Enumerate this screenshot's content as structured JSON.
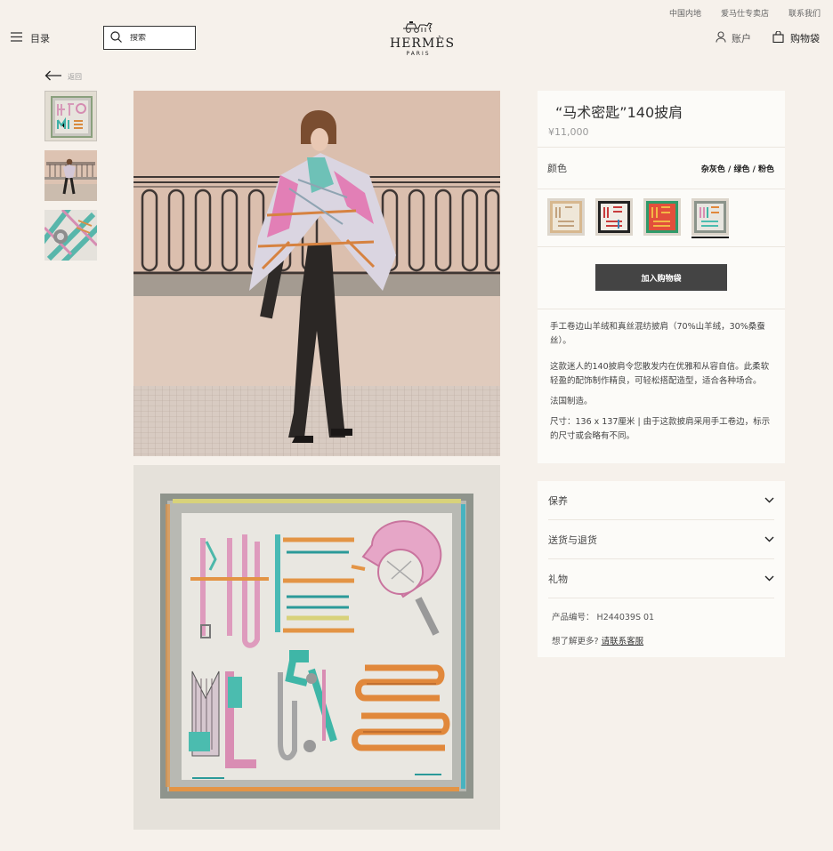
{
  "utility_links": [
    "中国内地",
    "爱马仕专卖店",
    "联系我们"
  ],
  "header": {
    "menu_label": "目录",
    "search_placeholder": "搜索",
    "brand": "HERMÈS",
    "brand_city": "PARIS",
    "account_label": "账户",
    "bag_label": "购物袋"
  },
  "back_label": "返回",
  "product": {
    "title": "“马术密匙”140披肩",
    "price": "¥11,000",
    "color_label": "颜色",
    "color_value": "杂灰色 / 绿色 / 粉色",
    "add_to_bag": "加入购物袋",
    "description": [
      "手工卷边山羊绒和真丝混纺披肩（70%山羊绒，30%桑蚕丝）。",
      "这款迷人的140披肩令您散发内在优雅和从容自信。此柔软轻盈的配饰制作精良，可轻松搭配造型，适合各种场合。",
      "法国制造。",
      "尺寸：136 x 137厘米 | 由于这款披肩采用手工卷边，标示的尺寸或会略有不同。"
    ]
  },
  "accordion": [
    "保养",
    "送货与退货",
    "礼物"
  ],
  "product_number_label": "产品编号：",
  "product_number": "H244039S 01",
  "help_text": "想了解更多?",
  "help_link": "请联系客服",
  "colors": {
    "background": "#f6f1eb",
    "panel": "#fcfbf8",
    "button": "#444444"
  }
}
